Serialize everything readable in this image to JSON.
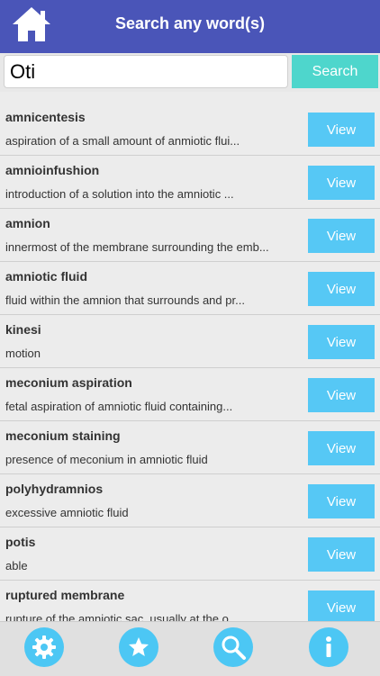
{
  "header": {
    "title": "Search any word(s)",
    "home_icon": "home-icon"
  },
  "search": {
    "value": "Oti",
    "button_label": "Search"
  },
  "results": [
    {
      "term": "amnicentesis",
      "definition": "aspiration of a small amount of anmiotic flui...",
      "view_label": "View"
    },
    {
      "term": "amnioinfushion",
      "definition": "introduction of a solution into the amniotic ...",
      "view_label": "View"
    },
    {
      "term": "amnion",
      "definition": "innermost of the membrane surrounding the emb...",
      "view_label": "View"
    },
    {
      "term": "amniotic fluid",
      "definition": "fluid within the amnion that surrounds and pr...",
      "view_label": "View"
    },
    {
      "term": "kinesi",
      "definition": "motion",
      "view_label": "View"
    },
    {
      "term": "meconium aspiration",
      "definition": "fetal aspiration of amniotic fluid containing...",
      "view_label": "View"
    },
    {
      "term": "meconium staining",
      "definition": "presence of meconium in amniotic fluid",
      "view_label": "View"
    },
    {
      "term": "polyhydramnios",
      "definition": "excessive amniotic fluid",
      "view_label": "View"
    },
    {
      "term": "potis",
      "definition": "able",
      "view_label": "View"
    },
    {
      "term": "ruptured membrane",
      "definition": "rupture of the amniotic sac, usually at the o...",
      "view_label": "View"
    }
  ],
  "tabbar": {
    "items": [
      {
        "icon": "gear-icon"
      },
      {
        "icon": "star-icon"
      },
      {
        "icon": "search-icon"
      },
      {
        "icon": "info-icon"
      }
    ]
  },
  "colors": {
    "header": "#4a55b8",
    "search_button": "#4ed6cc",
    "view_button": "#56c8f5",
    "tab_icon": "#4cc7f4"
  }
}
